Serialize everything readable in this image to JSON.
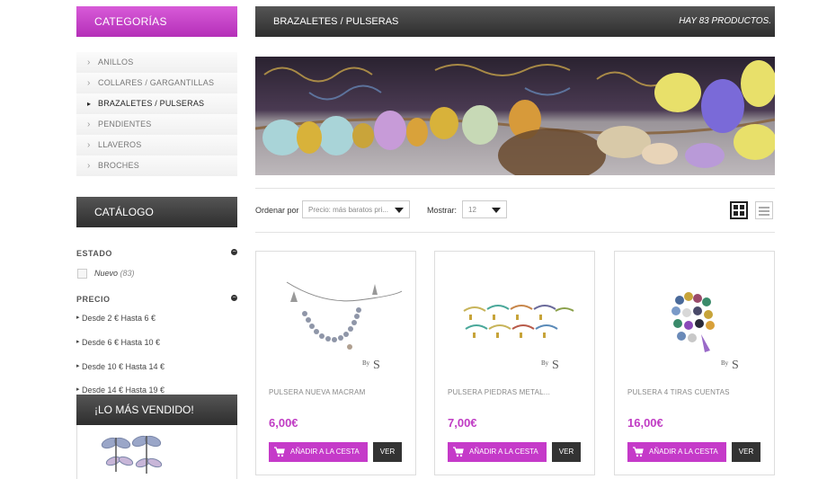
{
  "sidebar": {
    "categories_title": "CATEGORÍAS",
    "categories": [
      {
        "label": "ANILLOS",
        "active": false
      },
      {
        "label": "COLLARES / GARGANTILLAS",
        "active": false
      },
      {
        "label": "BRAZALETES / PULSERAS",
        "active": true
      },
      {
        "label": "PENDIENTES",
        "active": false
      },
      {
        "label": "LLAVEROS",
        "active": false
      },
      {
        "label": "BROCHES",
        "active": false
      }
    ],
    "catalog_title": "CATÁLOGO",
    "estado_title": "ESTADO",
    "estado_option": "Nuevo",
    "estado_count": "(83)",
    "precio_title": "PRECIO",
    "price_ranges": [
      "Desde 2 € Hasta 6 €",
      "Desde 6 € Hasta 10 €",
      "Desde 10 € Hasta 14 €",
      "Desde 14 € Hasta 19 €"
    ],
    "bestseller_title": "¡LO MÁS VENDIDO!"
  },
  "main": {
    "title": "BRAZALETES / PULSERAS",
    "product_count": "HAY 83 PRODUCTOS.",
    "sort_label": "Ordenar por",
    "sort_value": "Precio: más baratos pri...",
    "show_label": "Mostrar:",
    "show_value": "12"
  },
  "products": [
    {
      "name": "PULSERA NUEVA MACRAM",
      "price": "6,00€",
      "cart_label": "AÑADIR A LA CESTA",
      "view_label": "VER",
      "brand": "BySoloBea"
    },
    {
      "name": "PULSERA PIEDRAS METAL...",
      "price": "7,00€",
      "cart_label": "AÑADIR A LA CESTA",
      "view_label": "VER",
      "brand": "BySoloBea"
    },
    {
      "name": "PULSERA 4 TIRAS CUENTAS",
      "price": "16,00€",
      "cart_label": "AÑADIR A LA CESTA",
      "view_label": "VER",
      "brand": "BySoloBea"
    }
  ],
  "colors": {
    "accent": "#c53ac9",
    "dark_header": "#3a3a3a",
    "price": "#c03cc4"
  },
  "icons": {
    "cart": "cart-icon",
    "grid": "grid-view-icon",
    "list": "list-view-icon",
    "minus": "minus-circle-icon",
    "arrow": "chevron-right-icon"
  }
}
